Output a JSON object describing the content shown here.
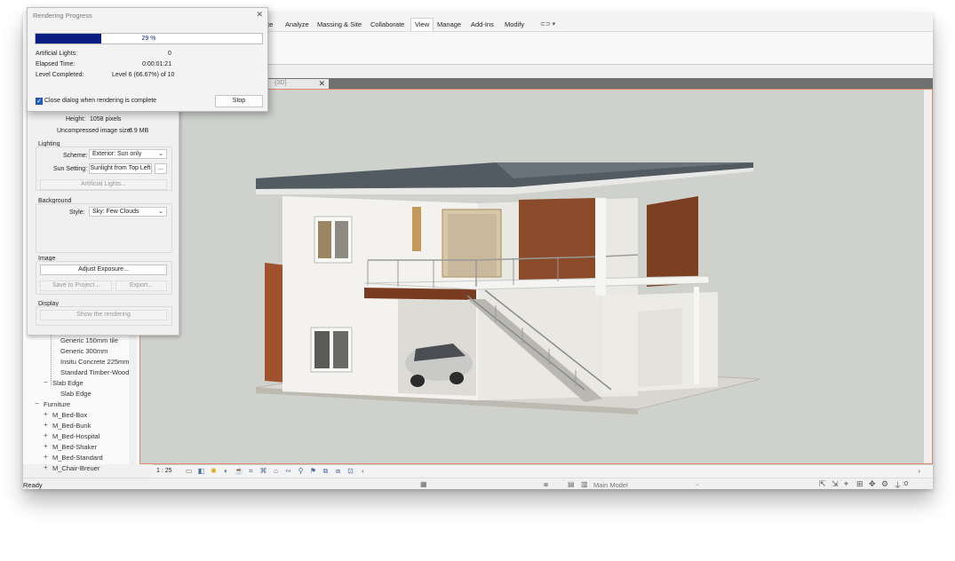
{
  "ribbon_tabs": [
    "te",
    "Analyze",
    "Massing & Site",
    "Collaborate",
    "View",
    "Manage",
    "Add-Ins",
    "Modify"
  ],
  "active_tab": "View",
  "view_tab": {
    "label": "{3D}",
    "close": "✕"
  },
  "dialog": {
    "title": "Rendering Progress",
    "close": "✕",
    "progress": {
      "percent": 29,
      "text": "29 %"
    },
    "stats": [
      {
        "label": "Artificial Lights:",
        "value": "0"
      },
      {
        "label": "Elapsed Time:",
        "value": "0:00:01:21"
      },
      {
        "label": "Level Completed:",
        "value": "Level 6 (66.67%) of 10"
      }
    ],
    "close_checkbox_label": "Close dialog when rendering is complete",
    "stop_label": "Stop"
  },
  "render_settings": {
    "height_label": "Height:",
    "height_value": "1058 pixels",
    "image_size_label": "Uncompressed image size:",
    "image_size_value": "8.9 MB",
    "lighting": {
      "header": "Lighting",
      "scheme_label": "Scheme:",
      "scheme_value": "Exterior: Sun only",
      "sun_label": "Sun Setting:",
      "sun_value": "Sunlight from Top Left",
      "sun_more": "...",
      "artificial_lights": "Artificial Lights..."
    },
    "background": {
      "header": "Background",
      "style_label": "Style:",
      "style_value": "Sky: Few Clouds"
    },
    "image": {
      "header": "Image",
      "adjust_exposure": "Adjust Exposure...",
      "save_to_project": "Save to Project...",
      "export": "Export..."
    },
    "display": {
      "header": "Display",
      "show_rendering": "Show the rendering"
    }
  },
  "browser": {
    "items": [
      {
        "label": "Generic 150mm tile",
        "toggle": ""
      },
      {
        "label": "Generic 300mm",
        "toggle": ""
      },
      {
        "label": "Insitu Concrete 225mm",
        "toggle": ""
      },
      {
        "label": "Standard Timber-Wood F",
        "toggle": ""
      },
      {
        "label": "Slab Edge",
        "toggle": "−"
      },
      {
        "label": "Slab Edge",
        "toggle": ""
      },
      {
        "label": "Furniture",
        "toggle": "−"
      },
      {
        "label": "M_Bed-Box",
        "toggle": "+"
      },
      {
        "label": "M_Bed-Bunk",
        "toggle": "+"
      },
      {
        "label": "M_Bed-Hospital",
        "toggle": "+"
      },
      {
        "label": "M_Bed-Shaker",
        "toggle": "+"
      },
      {
        "label": "M_Bed-Standard",
        "toggle": "+"
      },
      {
        "label": "M_Chair-Breuer",
        "toggle": "+"
      }
    ]
  },
  "view_control": {
    "scale": "1 : 25"
  },
  "status": {
    "ready": "Ready",
    "model": "Main Model",
    "filter_count": ":0"
  }
}
